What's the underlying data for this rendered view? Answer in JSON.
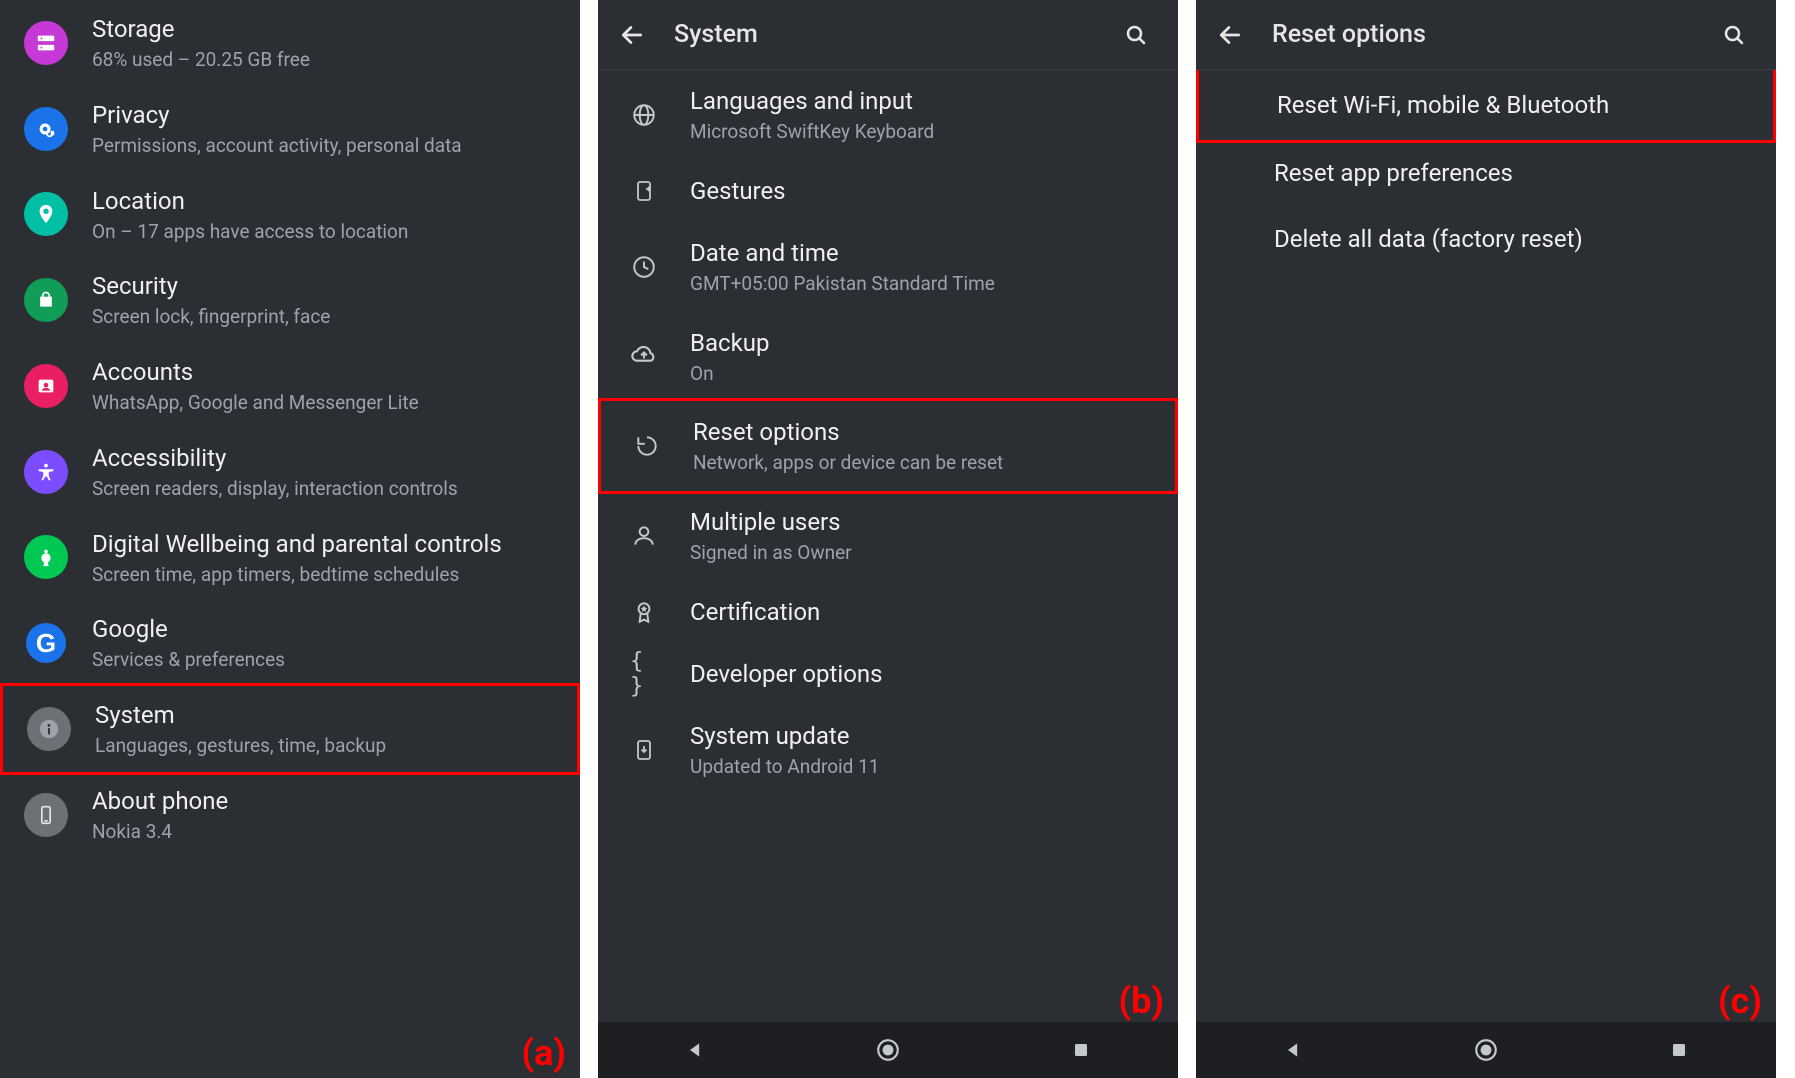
{
  "panelA": {
    "caption": "(a)",
    "items": [
      {
        "icon": "storage-icon",
        "color": "bg-magenta",
        "title": "Storage",
        "sub": "68% used – 20.25 GB free"
      },
      {
        "icon": "privacy-icon",
        "color": "bg-blue",
        "title": "Privacy",
        "sub": "Permissions, account activity, personal data"
      },
      {
        "icon": "location-icon",
        "color": "bg-teal",
        "title": "Location",
        "sub": "On – 17 apps have access to location"
      },
      {
        "icon": "security-icon",
        "color": "bg-green",
        "title": "Security",
        "sub": "Screen lock, fingerprint, face"
      },
      {
        "icon": "accounts-icon",
        "color": "bg-pink",
        "title": "Accounts",
        "sub": "WhatsApp, Google and Messenger Lite"
      },
      {
        "icon": "accessibility-icon",
        "color": "bg-violet",
        "title": "Accessibility",
        "sub": "Screen readers, display, interaction controls"
      },
      {
        "icon": "wellbeing-icon",
        "color": "bg-green2",
        "title": "Digital Wellbeing and parental controls",
        "sub": "Screen time, app timers, bedtime schedules"
      },
      {
        "icon": "google-icon",
        "color": "bg-bluegoogle",
        "title": "Google",
        "sub": "Services & preferences"
      },
      {
        "icon": "system-icon",
        "color": "bg-gray",
        "title": "System",
        "sub": "Languages, gestures, time, backup",
        "highlight": true
      },
      {
        "icon": "about-icon",
        "color": "bg-gray",
        "title": "About phone",
        "sub": "Nokia 3.4"
      }
    ]
  },
  "panelB": {
    "caption": "(b)",
    "header_title": "System",
    "items": [
      {
        "icon": "language-icon",
        "title": "Languages and input",
        "sub": "Microsoft SwiftKey Keyboard"
      },
      {
        "icon": "gesture-icon",
        "title": "Gestures",
        "sub": ""
      },
      {
        "icon": "clock-icon",
        "title": "Date and time",
        "sub": "GMT+05:00 Pakistan Standard Time"
      },
      {
        "icon": "backup-icon",
        "title": "Backup",
        "sub": "On"
      },
      {
        "icon": "reset-icon",
        "title": "Reset options",
        "sub": "Network, apps or device can be reset",
        "highlight": true
      },
      {
        "icon": "person-icon",
        "title": "Multiple users",
        "sub": "Signed in as Owner"
      },
      {
        "icon": "cert-icon",
        "title": "Certification",
        "sub": ""
      },
      {
        "icon": "dev-icon",
        "title": "Developer options",
        "sub": ""
      },
      {
        "icon": "update-icon",
        "title": "System update",
        "sub": "Updated to Android 11"
      }
    ]
  },
  "panelC": {
    "caption": "(c)",
    "header_title": "Reset options",
    "items": [
      {
        "title": "Reset Wi-Fi, mobile & Bluetooth",
        "highlight": true
      },
      {
        "title": "Reset app preferences"
      },
      {
        "title": "Delete all data (factory reset)"
      }
    ]
  }
}
